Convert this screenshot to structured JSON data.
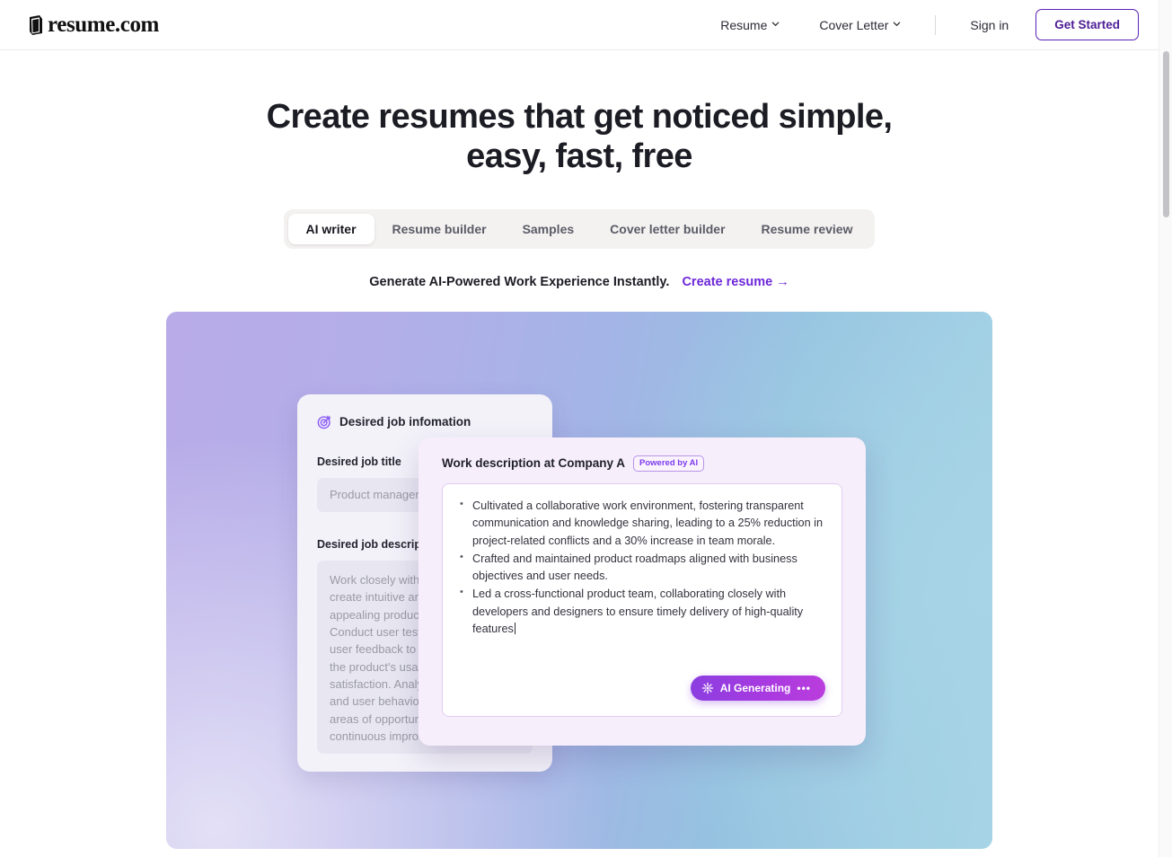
{
  "header": {
    "logo_text": "resume.com",
    "nav": [
      {
        "label": "Resume",
        "has_caret": true
      },
      {
        "label": "Cover Letter",
        "has_caret": true
      }
    ],
    "signin_label": "Sign in",
    "get_started_label": "Get Started"
  },
  "hero": {
    "headline_line1": "Create resumes that get noticed simple,",
    "headline_line2": "easy, fast, free",
    "tabs": [
      {
        "label": "AI writer",
        "active": true
      },
      {
        "label": "Resume builder",
        "active": false
      },
      {
        "label": "Samples",
        "active": false
      },
      {
        "label": "Cover letter builder",
        "active": false
      },
      {
        "label": "Resume review",
        "active": false
      }
    ],
    "subline_text": "Generate AI-Powered Work Experience Instantly.",
    "subline_cta": "Create resume →"
  },
  "job_info_card": {
    "title": "Desired job infomation",
    "job_title_label": "Desired job title",
    "job_title_placeholder": "Product manager",
    "job_description_label": "Desired job description",
    "job_description_value": "Work closely with designers to create intuitive and visually appealing product interfaces.\nConduct user testing and gather user feedback to iterate and improve the product's usability and overall satisfaction.\nAnalyze product metrics and user behavior data to identify areas of opportunities, and drive continuous improvement."
  },
  "work_description_card": {
    "title": "Work description at Company A",
    "badge": "Powered by AI",
    "bullets": [
      "Cultivated a collaborative work environment, fostering transparent communication and knowledge sharing, leading to a 25% reduction in project-related conflicts and a 30% increase in team morale.",
      "Crafted and maintained product roadmaps aligned with business objectives and user needs.",
      "Led a cross-functional product team, collaborating closely with developers and designers to ensure timely delivery of high-quality features"
    ],
    "ai_button_label": "AI Generating",
    "ai_button_dots": "•••"
  },
  "colors": {
    "accent_purple": "#6d28d9",
    "button_border": "#5b21b6",
    "badge_purple": "#7c3aed",
    "gradient_left": "#b8abe8",
    "gradient_right": "#a6d4e5"
  }
}
